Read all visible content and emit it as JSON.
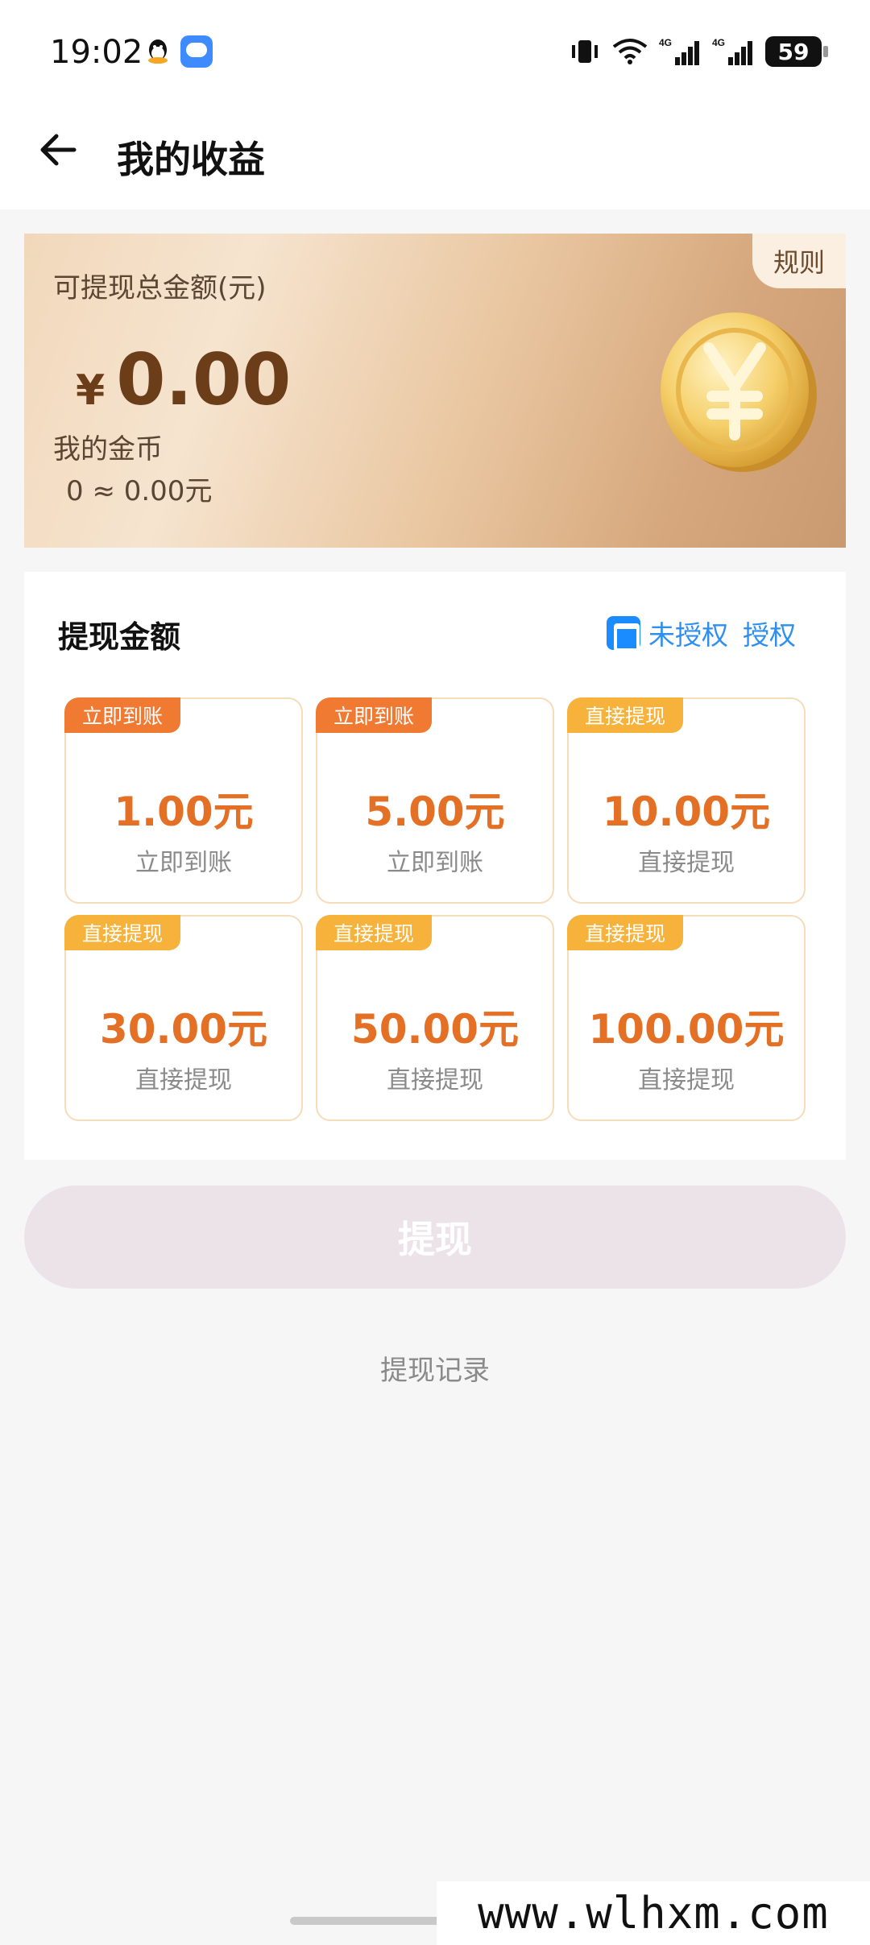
{
  "status_bar": {
    "time": "19:02",
    "battery": "59",
    "icons": [
      "qq-icon",
      "message-icon",
      "vibrate-icon",
      "wifi-icon",
      "signal-4g-icon",
      "signal-4g-icon",
      "battery-icon"
    ]
  },
  "header": {
    "title": "我的收益",
    "back_icon": "back-arrow-icon"
  },
  "earnings": {
    "rules_label": "规则",
    "total_label": "可提现总金额(元)",
    "currency": "¥",
    "total_amount": "0.00",
    "coins_label": "我的金币",
    "coins_value": "0 ≈ 0.00元"
  },
  "withdraw": {
    "title": "提现金额",
    "auth_status": "未授权",
    "auth_link": "授权",
    "options": [
      {
        "badge": "立即到账",
        "amount": "1.00元",
        "subtitle": "立即到账"
      },
      {
        "badge": "立即到账",
        "amount": "5.00元",
        "subtitle": "立即到账"
      },
      {
        "badge": "直接提现",
        "amount": "10.00元",
        "subtitle": "直接提现"
      },
      {
        "badge": "直接提现",
        "amount": "30.00元",
        "subtitle": "直接提现"
      },
      {
        "badge": "直接提现",
        "amount": "50.00元",
        "subtitle": "直接提现"
      },
      {
        "badge": "直接提现",
        "amount": "100.00元",
        "subtitle": "直接提现"
      }
    ]
  },
  "actions": {
    "withdraw_button": "提现",
    "records_link": "提现记录"
  },
  "watermark": "www.wlhxm.com",
  "colors": {
    "accent_orange": "#e47025",
    "badge_instant": "#f07a32",
    "badge_direct": "#f6b23a",
    "link_blue": "#2f8ff0",
    "button_disabled": "#ebe3e8"
  }
}
